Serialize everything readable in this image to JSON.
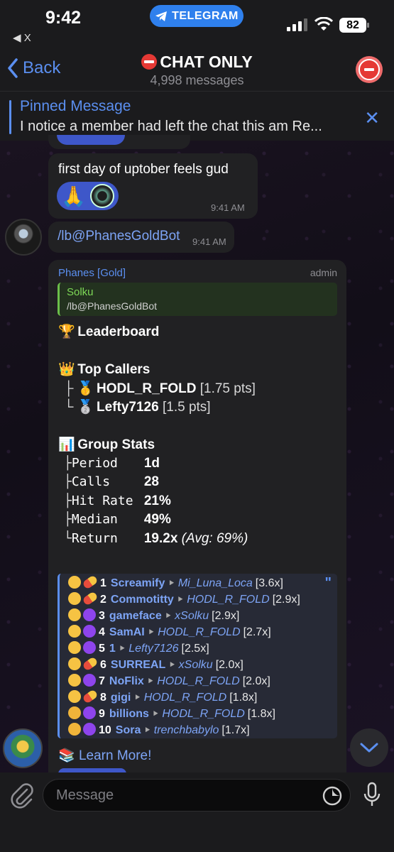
{
  "status": {
    "time": "9:42",
    "back_app": "◀ X",
    "pill": "TELEGRAM",
    "battery": "82"
  },
  "header": {
    "back": "Back",
    "title": "CHAT ONLY",
    "subtitle": "4,998 messages"
  },
  "pinned": {
    "title": "Pinned Message",
    "text": "I notice a member had left the chat this am Re..."
  },
  "messages": {
    "m1": {
      "text": "first day of uptober feels gud",
      "time": "9:41 AM",
      "reaction": "🙏"
    },
    "m2": {
      "text": "/lb@PhanesGoldBot",
      "time": "9:41 AM"
    }
  },
  "bot": {
    "name": "Phanes [Gold]",
    "role": "admin",
    "reply_name": "Solku",
    "reply_text": "/lb@PhanesGoldBot",
    "leaderboard_title": "Leaderboard",
    "top_callers_title": "Top Callers",
    "callers": [
      {
        "prefix": "├",
        "medal": "🥇",
        "name": "HODL_R_FOLD",
        "pts": "[1.75 pts]"
      },
      {
        "prefix": "└",
        "medal": "🥈",
        "name": "Lefty7126",
        "pts": "[1.5 pts]"
      }
    ],
    "group_stats_title": "Group Stats",
    "stats": [
      {
        "prefix": "├",
        "label": "Period",
        "value": "1d",
        "extra": ""
      },
      {
        "prefix": "├",
        "label": "Calls",
        "value": "28",
        "extra": ""
      },
      {
        "prefix": "├",
        "label": "Hit Rate",
        "value": "21%",
        "extra": ""
      },
      {
        "prefix": "├",
        "label": "Median",
        "value": "49%",
        "extra": ""
      },
      {
        "prefix": "└",
        "label": "Return",
        "value": "19.2x",
        "extra": "(Avg: 69%)"
      }
    ],
    "ranking": [
      {
        "rank": "1",
        "coin": "Screamify",
        "user": "Mi_Luna_Loca",
        "mult": "[3.6x]",
        "badge": "pill",
        "face": "cool"
      },
      {
        "rank": "2",
        "coin": "Commotitty",
        "user": "HODL_R_FOLD",
        "mult": "[2.9x]",
        "badge": "pill",
        "face": "cool"
      },
      {
        "rank": "3",
        "coin": "gameface",
        "user": "xSolku",
        "mult": "[2.9x]",
        "badge": "dot",
        "face": "cool"
      },
      {
        "rank": "4",
        "coin": "SamAI",
        "user": "HODL_R_FOLD",
        "mult": "[2.7x]",
        "badge": "dot",
        "face": "cool"
      },
      {
        "rank": "5",
        "coin": "1",
        "user": "Lefty7126",
        "mult": "[2.5x]",
        "badge": "dot",
        "face": "cool"
      },
      {
        "rank": "6",
        "coin": "SURREAL",
        "user": "xSolku",
        "mult": "[2.0x]",
        "badge": "pill",
        "face": "cool"
      },
      {
        "rank": "7",
        "coin": "NoFlix",
        "user": "HODL_R_FOLD",
        "mult": "[2.0x]",
        "badge": "dot",
        "face": "cool"
      },
      {
        "rank": "8",
        "coin": "gigi",
        "user": "HODL_R_FOLD",
        "mult": "[1.8x]",
        "badge": "pill",
        "face": "cool"
      },
      {
        "rank": "9",
        "coin": "billions",
        "user": "HODL_R_FOLD",
        "mult": "[1.8x]",
        "badge": "dot",
        "face": "yawn"
      },
      {
        "rank": "10",
        "coin": "Sora",
        "user": "trenchbabylo",
        "mult": "[1.7x]",
        "badge": "dot",
        "face": "yawn"
      }
    ],
    "learn_more": "Learn More!"
  },
  "input": {
    "placeholder": "Message"
  },
  "colors": {
    "accent": "#5b8ff0",
    "link": "#7da4f5",
    "reply_green": "#7ed957",
    "bubble": "#212123"
  }
}
